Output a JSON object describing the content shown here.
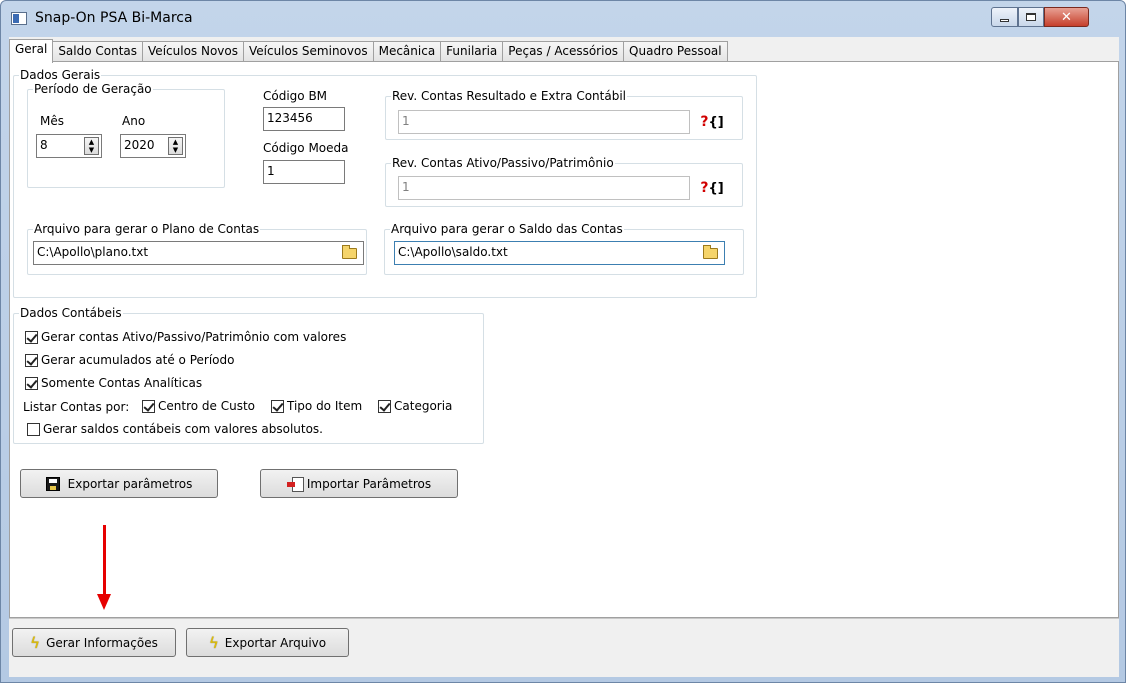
{
  "window": {
    "title": "Snap-On PSA Bi-Marca",
    "close_glyph": "✕"
  },
  "tabs": [
    {
      "label": "Geral",
      "active": true
    },
    {
      "label": "Saldo Contas",
      "active": false
    },
    {
      "label": "Veículos Novos",
      "active": false
    },
    {
      "label": "Veículos Seminovos",
      "active": false
    },
    {
      "label": "Mecânica",
      "active": false
    },
    {
      "label": "Funilaria",
      "active": false
    },
    {
      "label": "Peças / Acessórios",
      "active": false
    },
    {
      "label": "Quadro Pessoal",
      "active": false
    }
  ],
  "dados_gerais": {
    "legend": "Dados Gerais",
    "periodo": {
      "legend": "Período de Geração",
      "mes_label": "Mês",
      "mes_value": "8",
      "ano_label": "Ano",
      "ano_value": "2020"
    },
    "codigo_bm_label": "Código BM",
    "codigo_bm_value": "123456",
    "codigo_moeda_label": "Código Moeda",
    "codigo_moeda_value": "1",
    "rev_resultado": {
      "legend": "Rev. Contas Resultado e Extra Contábil",
      "value": "1"
    },
    "rev_ativo": {
      "legend": "Rev. Contas Ativo/Passivo/Patrimônio",
      "value": "1"
    },
    "lookup_q": "?",
    "lookup_b": "{]",
    "arquivo_plano": {
      "legend": "Arquivo para gerar o Plano de Contas",
      "value": "C:\\Apollo\\plano.txt"
    },
    "arquivo_saldo": {
      "legend": "Arquivo para gerar o Saldo das Contas",
      "value": "C:\\Apollo\\saldo.txt"
    }
  },
  "dados_contabeis": {
    "legend": "Dados Contábeis",
    "gerar_ativo": {
      "label": "Gerar contas Ativo/Passivo/Patrimônio com valores",
      "checked": true
    },
    "gerar_acumulados": {
      "label": "Gerar acumulados até o Período",
      "checked": true
    },
    "somente_analiticas": {
      "label": "Somente Contas Analíticas",
      "checked": true
    },
    "listar_label": "Listar Contas por:",
    "centro_custo": {
      "label": "Centro de Custo",
      "checked": true
    },
    "tipo_item": {
      "label": "Tipo do Item",
      "checked": true
    },
    "categoria": {
      "label": "Categoria",
      "checked": true
    },
    "saldos_absolutos": {
      "label": "Gerar saldos contábeis com valores absolutos.",
      "checked": false
    }
  },
  "buttons": {
    "exportar_parametros": "Exportar parâmetros",
    "importar_parametros": "Importar Parâmetros",
    "gerar_informacoes": "Gerar Informações",
    "exportar_arquivo": "Exportar Arquivo"
  },
  "colors": {
    "annotation_arrow": "#e60000",
    "bolt": "#e2c000"
  }
}
